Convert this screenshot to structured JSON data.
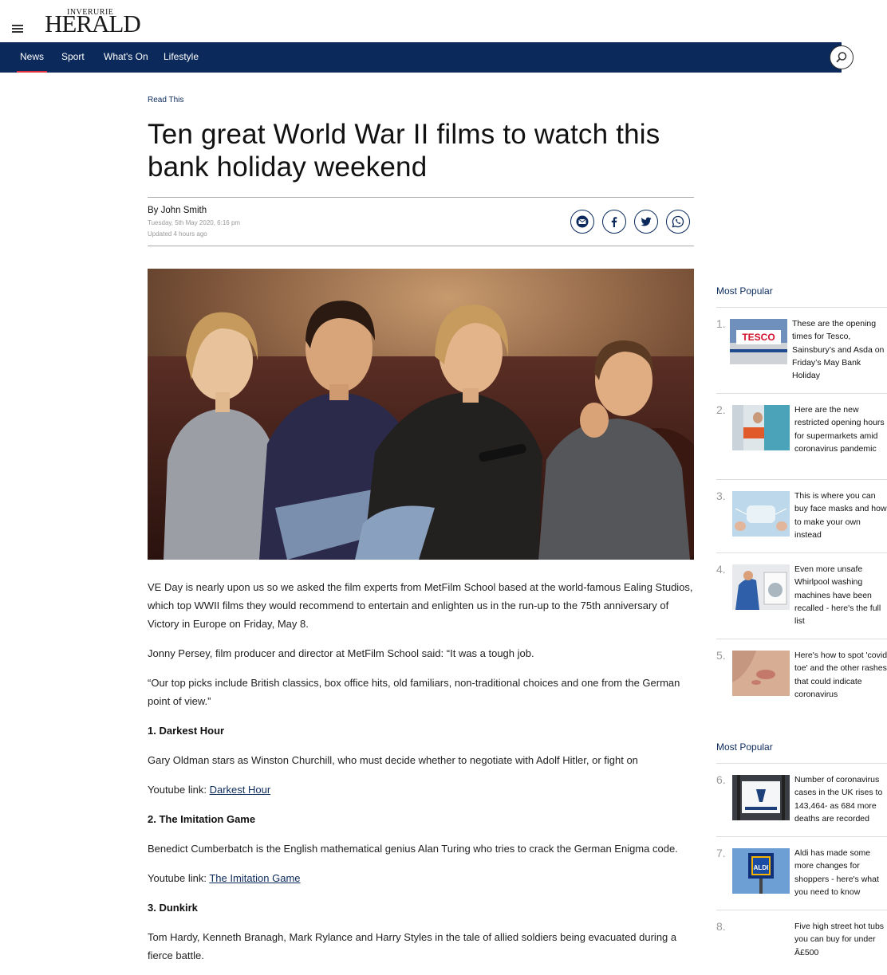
{
  "header": {
    "logo_small": "INVERURIE",
    "logo_big": "HERALD",
    "nav": [
      "News",
      "Sport",
      "What's On",
      "Lifestyle"
    ]
  },
  "article": {
    "kicker": "Read This",
    "headline": "Ten great World War II films to watch this bank holiday weekend",
    "byline_prefix": "By",
    "author": "John Smith",
    "date": "Tuesday, 5th May 2020, 6:16 pm",
    "updated": "Updated  4 hours ago",
    "paragraphs": {
      "p1": "VE Day is nearly upon us so we asked the film experts from MetFilm School based at the world-famous Ealing Studios, which top WWII films they would recommend to entertain and enlighten us in the run-up to the 75th anniversary of Victory in Europe on Friday, May 8.",
      "p2": "Jonny Persey, film producer and director at MetFilm School said: “It was a tough job.",
      "p3": "“Our top picks include British classics, box office hits, old familiars, non-traditional choices and one from the German point of view.”",
      "h1": "1. Darkest Hour",
      "p4": "Gary Oldman stars as Winston Churchill, who must decide whether to negotiate with Adolf Hitler, or fight on",
      "yt_label": "Youtube link: ",
      "yt1": "Darkest Hour",
      "h2": "2. The Imitation Game",
      "p5": "Benedict Cumberbatch is the English mathematical genius Alan Turing who tries to crack the German Enigma code.",
      "yt2": "The Imitation Game",
      "h3": "3. Dunkirk",
      "p6": "Tom Hardy, Kenneth Branagh, Mark Rylance and Harry Styles in the tale of allied soldiers being evacuated during a fierce battle."
    }
  },
  "sidebar": {
    "title1": "Most Popular",
    "title2": "Most Popular",
    "items": [
      {
        "num": "1.",
        "text": "These are the opening times for Tesco, Sainsbury’s and Asda on Friday’s May Bank Holiday",
        "thumb_label": "TESCO"
      },
      {
        "num": "2.",
        "text": "Here are the new restricted opening hours for supermarkets amid coronavirus pandemic"
      },
      {
        "num": "3.",
        "text": "This is where you can buy face masks and how to make your own instead"
      },
      {
        "num": "4.",
        "text": "Even more unsafe Whirlpool washing machines have been recalled - here's the full list"
      },
      {
        "num": "5.",
        "text": "Here's how to spot 'covid toe' and the other rashes that could indicate coronavirus"
      },
      {
        "num": "6.",
        "text": "Number of coronavirus cases in the UK rises to 143,464- as 684 more deaths are recorded"
      },
      {
        "num": "7.",
        "text": "Aldi has made some more changes for shoppers - here's what you need to know",
        "thumb_label": "ALDI"
      },
      {
        "num": "8.",
        "text": "Five high street hot tubs you can buy for under Â£500"
      }
    ]
  },
  "colors": {
    "brand_navy": "#0b2a5b",
    "nav_active": "#e0303a"
  }
}
